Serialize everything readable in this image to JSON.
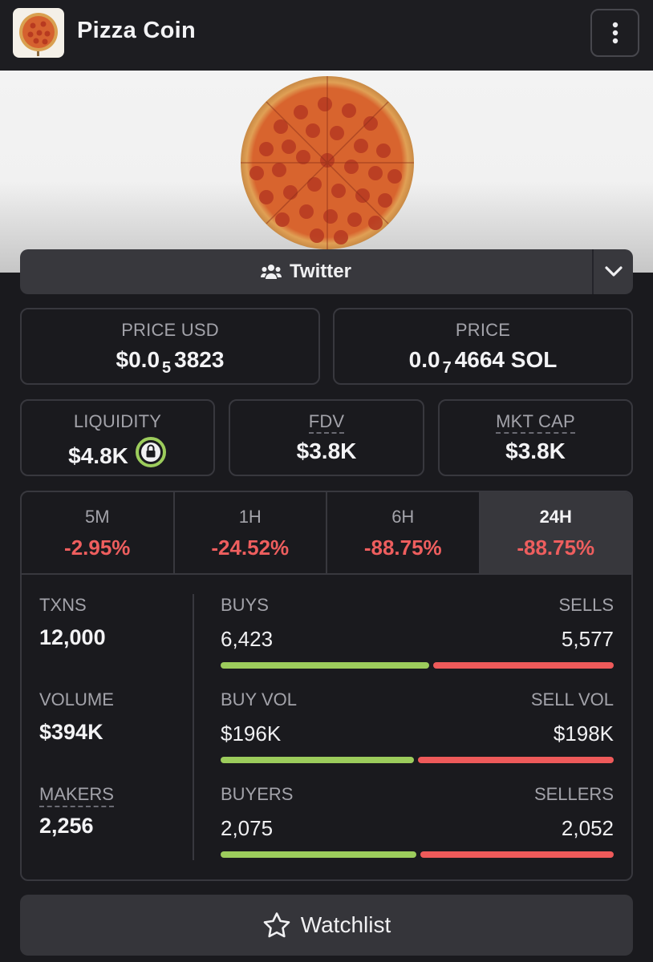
{
  "header": {
    "title": "Pizza Coin"
  },
  "social": {
    "label": "Twitter",
    "icon": "users-icon"
  },
  "prices": {
    "usd": {
      "label": "PRICE USD",
      "prefix": "$0.0",
      "zeros": "5",
      "digits": "3823"
    },
    "native": {
      "label": "PRICE",
      "prefix": "0.0",
      "zeros": "7",
      "digits": "4664",
      "unit": "SOL"
    }
  },
  "cards": {
    "liquidity": {
      "label": "LIQUIDITY",
      "value": "$4.8K"
    },
    "fdv": {
      "label": "FDV",
      "value": "$3.8K"
    },
    "mktcap": {
      "label": "MKT CAP",
      "value": "$3.8K"
    }
  },
  "timeframes": [
    {
      "label": "5M",
      "change": "-2.95%"
    },
    {
      "label": "1H",
      "change": "-24.52%"
    },
    {
      "label": "6H",
      "change": "-88.75%"
    },
    {
      "label": "24H",
      "change": "-88.75%"
    }
  ],
  "active_timeframe": "24H",
  "metrics": {
    "txns": {
      "label": "TXNS",
      "value": "12,000"
    },
    "volume": {
      "label": "VOLUME",
      "value": "$394K"
    },
    "makers": {
      "label": "MAKERS",
      "value": "2,256"
    }
  },
  "pairs": {
    "txns": {
      "left_label": "BUYS",
      "left_value": "6,423",
      "right_label": "SELLS",
      "right_value": "5,577",
      "buy_fraction": 0.535
    },
    "volume": {
      "left_label": "BUY VOL",
      "left_value": "$196K",
      "right_label": "SELL VOL",
      "right_value": "$198K",
      "buy_fraction": 0.497
    },
    "makers": {
      "left_label": "BUYERS",
      "left_value": "2,075",
      "right_label": "SELLERS",
      "right_value": "2,052",
      "buy_fraction": 0.503
    }
  },
  "watchlist": {
    "label": "Watchlist"
  },
  "colors": {
    "positive": "#9ccc5c",
    "negative": "#ee5e5e",
    "lock": "#9ccc5c"
  }
}
